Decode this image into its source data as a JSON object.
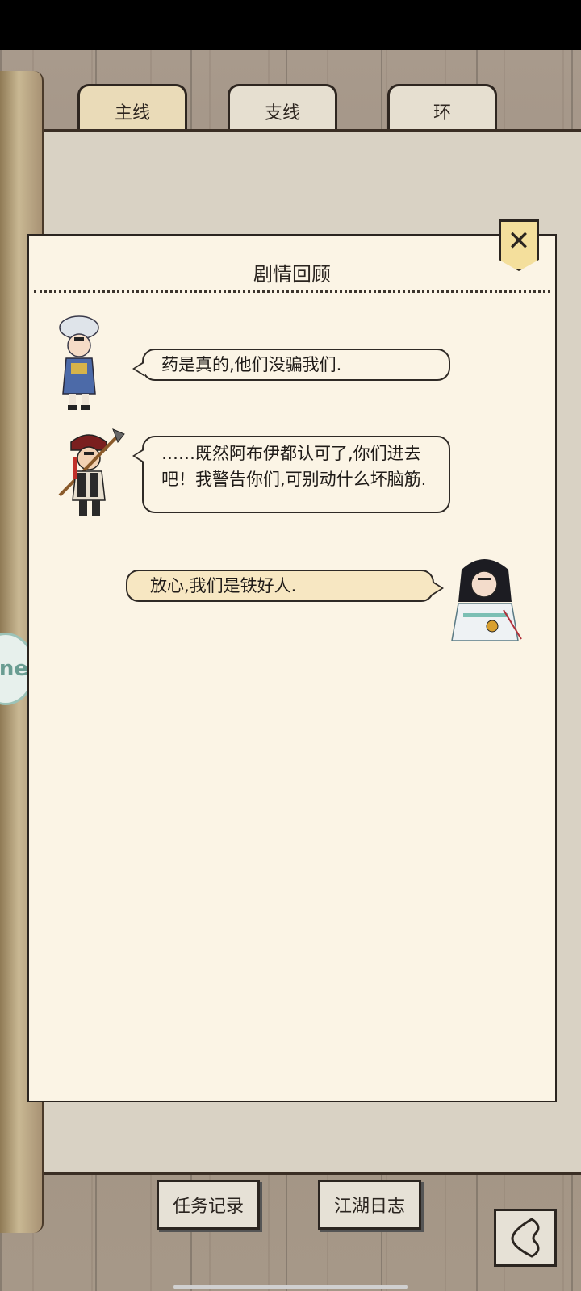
{
  "tabs": {
    "main": "主线",
    "branch": "支线",
    "ring": "环"
  },
  "side_badge": "ne",
  "dialog": {
    "title": "剧情回顾",
    "close_glyph": "✕",
    "messages": [
      {
        "speaker": "left",
        "avatar": "miao-girl-avatar",
        "text": "药是真的,他们没骗我们."
      },
      {
        "speaker": "left",
        "avatar": "axe-villager-avatar",
        "text": "……既然阿布伊都认可了,你们进去吧！我警告你们,可别动什么坏脑筋."
      },
      {
        "speaker": "right",
        "avatar": "swordsman-avatar",
        "text": "放心,我们是铁好人."
      }
    ]
  },
  "bottom": {
    "task_log": "任务记录",
    "jianghu_log": "江湖日志"
  },
  "colors": {
    "parchment": "#fbf4e5",
    "player_bubble": "#f7e7c2",
    "close_tag": "#f4df9c"
  }
}
